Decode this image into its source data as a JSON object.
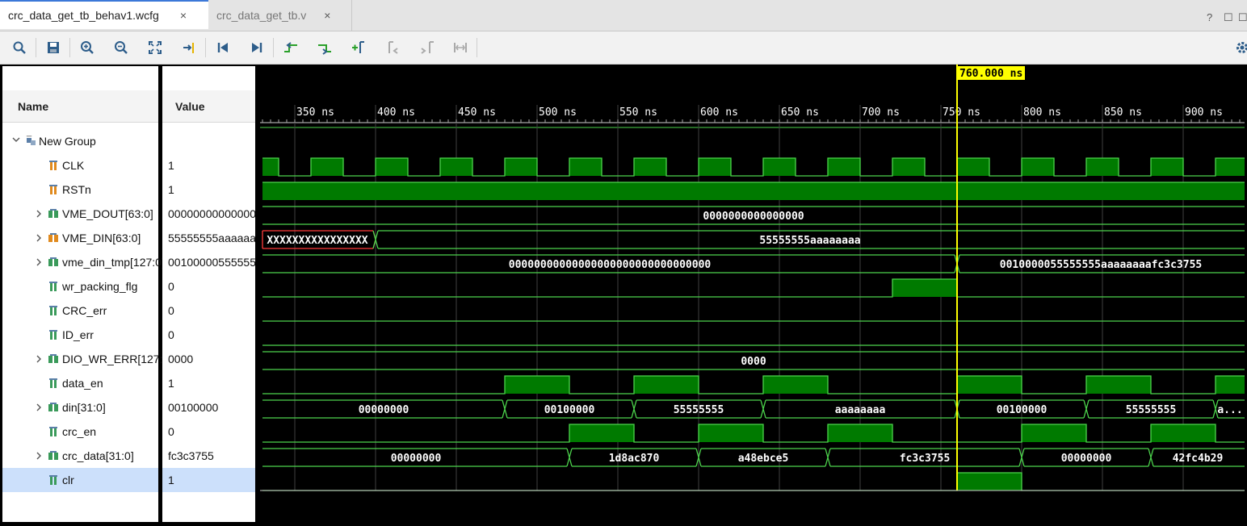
{
  "tabs": [
    {
      "label": "crc_data_get_tb_behav1.wcfg",
      "close": "×"
    },
    {
      "label": "crc_data_get_tb.v",
      "close": "×"
    }
  ],
  "window_buttons": {
    "help": "?",
    "restore": "☐",
    "maximize": "☐"
  },
  "toolbar": {
    "buttons": [
      "search",
      "save",
      "zoom-in",
      "zoom-out",
      "zoom-fit",
      "go-to-cursor",
      "go-to-time-zero",
      "go-to-last-time",
      "previous-transition",
      "next-transition",
      "add-marker",
      "previous-marker",
      "next-marker",
      "swap-cursors"
    ],
    "settings": "gear"
  },
  "columns": {
    "name": "Name",
    "value": "Value"
  },
  "tree_group_partial": "_",
  "group": {
    "name": "New Group"
  },
  "signals": [
    {
      "name": "CLK",
      "value": "1",
      "expandable": false,
      "icon": "bit-orange"
    },
    {
      "name": "RSTn",
      "value": "1",
      "expandable": false,
      "icon": "bit-orange"
    },
    {
      "name": "VME_DOUT[63:0]",
      "value": "0000000000000000",
      "expandable": true,
      "icon": "bus-green"
    },
    {
      "name": "VME_DIN[63:0]",
      "value": "55555555aaaaaaaa",
      "expandable": true,
      "icon": "bus-orange"
    },
    {
      "name": "vme_din_tmp[127:0]",
      "value": "0010000055555555aaaaaaaafc3c3755",
      "expandable": true,
      "icon": "bus-green"
    },
    {
      "name": "wr_packing_flg",
      "value": "0",
      "expandable": false,
      "icon": "bit-green"
    },
    {
      "name": "CRC_err",
      "value": "0",
      "expandable": false,
      "icon": "bit-green"
    },
    {
      "name": "ID_err",
      "value": "0",
      "expandable": false,
      "icon": "bit-green"
    },
    {
      "name": "DIO_WR_ERR[127:0]",
      "value": "0000",
      "expandable": true,
      "icon": "bus-green"
    },
    {
      "name": "data_en",
      "value": "1",
      "expandable": false,
      "icon": "bit-green"
    },
    {
      "name": "din[31:0]",
      "value": "00100000",
      "expandable": true,
      "icon": "bus-green"
    },
    {
      "name": "crc_en",
      "value": "0",
      "expandable": false,
      "icon": "bit-green"
    },
    {
      "name": "crc_data[31:0]",
      "value": "fc3c3755",
      "expandable": true,
      "icon": "bus-green"
    },
    {
      "name": "clr",
      "value": "1",
      "expandable": false,
      "icon": "bit-green",
      "selected": true
    }
  ],
  "waveform": {
    "time_unit": "ns",
    "view_start_ns": 330,
    "view_end_ns": 938,
    "tick_labels": [
      "350 ns",
      "400 ns",
      "450 ns",
      "500 ns",
      "550 ns",
      "600 ns",
      "650 ns",
      "700 ns",
      "750 ns",
      "800 ns",
      "850 ns",
      "900 ns"
    ],
    "tick_values": [
      350,
      400,
      450,
      500,
      550,
      600,
      650,
      700,
      750,
      800,
      850,
      900
    ],
    "cursor": {
      "time_ns": 760,
      "label": "760.000 ns"
    },
    "colors": {
      "trace": "#4cd44c",
      "fill": "#007a00",
      "cursor": "#ffff00",
      "undefined": "#ff3b3b",
      "grid": "#404040",
      "text": "#ffffff"
    },
    "traces": [
      {
        "signal": "CLK",
        "kind": "bit",
        "edges": [
          [
            330,
            1
          ],
          [
            340,
            0
          ],
          [
            360,
            1
          ],
          [
            380,
            0
          ],
          [
            400,
            1
          ],
          [
            420,
            0
          ],
          [
            440,
            1
          ],
          [
            460,
            0
          ],
          [
            480,
            1
          ],
          [
            500,
            0
          ],
          [
            520,
            1
          ],
          [
            540,
            0
          ],
          [
            560,
            1
          ],
          [
            580,
            0
          ],
          [
            600,
            1
          ],
          [
            620,
            0
          ],
          [
            640,
            1
          ],
          [
            660,
            0
          ],
          [
            680,
            1
          ],
          [
            700,
            0
          ],
          [
            720,
            1
          ],
          [
            740,
            0
          ],
          [
            760,
            1
          ],
          [
            780,
            0
          ],
          [
            800,
            1
          ],
          [
            820,
            0
          ],
          [
            840,
            1
          ],
          [
            860,
            0
          ],
          [
            880,
            1
          ],
          [
            900,
            0
          ],
          [
            920,
            1
          ]
        ]
      },
      {
        "signal": "RSTn",
        "kind": "bit",
        "edges": [
          [
            330,
            1
          ]
        ]
      },
      {
        "signal": "VME_DOUT[63:0]",
        "kind": "bus",
        "segments": [
          {
            "t0": 330,
            "t1": 938,
            "label": "0000000000000000"
          }
        ]
      },
      {
        "signal": "VME_DIN[63:0]",
        "kind": "bus",
        "segments": [
          {
            "t0": 330,
            "t1": 400,
            "label": "XXXXXXXXXXXXXXXX",
            "undefined": true
          },
          {
            "t0": 400,
            "t1": 938,
            "label": "55555555aaaaaaaa"
          }
        ]
      },
      {
        "signal": "vme_din_tmp[127:0]",
        "kind": "bus",
        "segments": [
          {
            "t0": 330,
            "t1": 760,
            "label": "00000000000000000000000000000000"
          },
          {
            "t0": 760,
            "t1": 938,
            "label": "0010000055555555aaaaaaaafc3c3755"
          }
        ]
      },
      {
        "signal": "wr_packing_flg",
        "kind": "bit",
        "edges": [
          [
            330,
            0
          ],
          [
            720,
            1
          ],
          [
            760,
            0
          ]
        ]
      },
      {
        "signal": "CRC_err",
        "kind": "bit",
        "edges": [
          [
            330,
            0
          ]
        ]
      },
      {
        "signal": "ID_err",
        "kind": "bit",
        "edges": [
          [
            330,
            0
          ]
        ]
      },
      {
        "signal": "DIO_WR_ERR[127:0]",
        "kind": "bus",
        "segments": [
          {
            "t0": 330,
            "t1": 938,
            "label": "0000"
          }
        ]
      },
      {
        "signal": "data_en",
        "kind": "bit",
        "edges": [
          [
            330,
            0
          ],
          [
            480,
            1
          ],
          [
            520,
            0
          ],
          [
            560,
            1
          ],
          [
            600,
            0
          ],
          [
            640,
            1
          ],
          [
            680,
            0
          ],
          [
            760,
            1
          ],
          [
            800,
            0
          ],
          [
            840,
            1
          ],
          [
            880,
            0
          ],
          [
            920,
            1
          ]
        ]
      },
      {
        "signal": "din[31:0]",
        "kind": "bus",
        "segments": [
          {
            "t0": 330,
            "t1": 480,
            "label": "00000000"
          },
          {
            "t0": 480,
            "t1": 560,
            "label": "00100000"
          },
          {
            "t0": 560,
            "t1": 640,
            "label": "55555555"
          },
          {
            "t0": 640,
            "t1": 760,
            "label": "aaaaaaaa"
          },
          {
            "t0": 760,
            "t1": 840,
            "label": "00100000"
          },
          {
            "t0": 840,
            "t1": 920,
            "label": "55555555"
          },
          {
            "t0": 920,
            "t1": 938,
            "label": "a..."
          }
        ]
      },
      {
        "signal": "crc_en",
        "kind": "bit",
        "edges": [
          [
            330,
            0
          ],
          [
            520,
            1
          ],
          [
            560,
            0
          ],
          [
            600,
            1
          ],
          [
            640,
            0
          ],
          [
            680,
            1
          ],
          [
            720,
            0
          ],
          [
            800,
            1
          ],
          [
            840,
            0
          ],
          [
            880,
            1
          ],
          [
            920,
            0
          ]
        ]
      },
      {
        "signal": "crc_data[31:0]",
        "kind": "bus",
        "segments": [
          {
            "t0": 330,
            "t1": 520,
            "label": "00000000"
          },
          {
            "t0": 520,
            "t1": 600,
            "label": "1d8ac870"
          },
          {
            "t0": 600,
            "t1": 680,
            "label": "a48ebce5"
          },
          {
            "t0": 680,
            "t1": 800,
            "label": "fc3c3755"
          },
          {
            "t0": 800,
            "t1": 880,
            "label": "00000000"
          },
          {
            "t0": 880,
            "t1": 938,
            "label": "42fc4b29"
          }
        ]
      },
      {
        "signal": "clr",
        "kind": "bit",
        "edges": [
          [
            330,
            0
          ],
          [
            760,
            1
          ],
          [
            800,
            0
          ]
        ]
      }
    ]
  }
}
